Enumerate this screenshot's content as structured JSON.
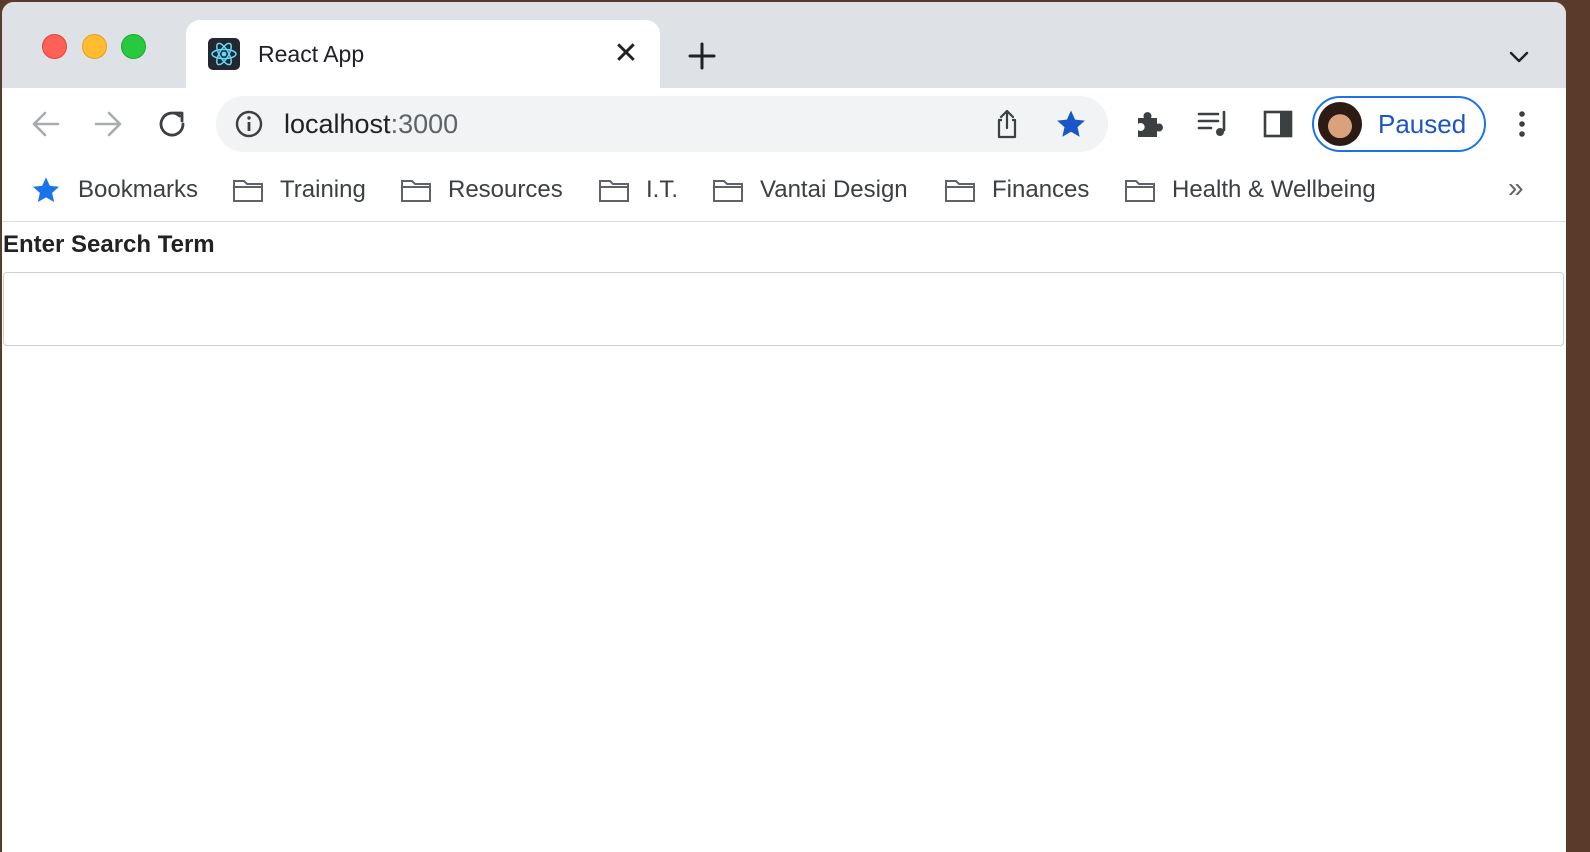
{
  "tab": {
    "title": "React App",
    "close_glyph": "✕",
    "favicon": "react-logo-icon"
  },
  "omnibox": {
    "host": "localhost",
    "port": ":3000"
  },
  "profile": {
    "label": "Paused"
  },
  "bookmarks": {
    "items": [
      {
        "label": "Bookmarks",
        "icon": "star-icon"
      },
      {
        "label": "Training",
        "icon": "folder-icon"
      },
      {
        "label": "Resources",
        "icon": "folder-icon"
      },
      {
        "label": "I.T.",
        "icon": "folder-icon"
      },
      {
        "label": "Vantai Design",
        "icon": "folder-icon"
      },
      {
        "label": "Finances",
        "icon": "folder-icon"
      },
      {
        "label": "Health & Wellbeing",
        "icon": "folder-icon"
      }
    ],
    "more_glyph": "»"
  },
  "page": {
    "search_label": "Enter Search Term",
    "search_value": ""
  },
  "colors": {
    "accent": "#1a73e8",
    "star": "#1a56c8",
    "tabstrip": "#dee1e6"
  }
}
